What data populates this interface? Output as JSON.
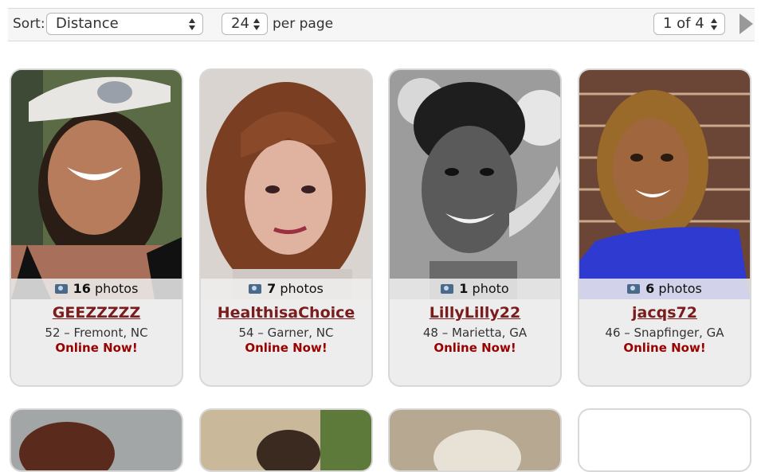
{
  "toolbar": {
    "sort_label": "Sort:",
    "sort_value": "Distance",
    "per_page_value": "24",
    "per_page_label": "per page",
    "page_value": "1 of 4"
  },
  "profiles": [
    {
      "count": "16",
      "photos_word": "photos",
      "username": "GEEZZZZZ",
      "info": "52 – Fremont, NC",
      "status": "Online Now!"
    },
    {
      "count": "7",
      "photos_word": "photos",
      "username": "HealthisaChoice",
      "info": "54 – Garner, NC",
      "status": "Online Now!"
    },
    {
      "count": "1",
      "photos_word": "photo",
      "username": "LillyLilly22",
      "info": "48 – Marietta, GA",
      "status": "Online Now!"
    },
    {
      "count": "6",
      "photos_word": "photos",
      "username": "jacqs72",
      "info": "46 – Snapfinger, GA",
      "status": "Online Now!"
    }
  ],
  "colors": {
    "username": "#7a1c1c",
    "online": "#990000",
    "card_bg": "#ededed"
  }
}
